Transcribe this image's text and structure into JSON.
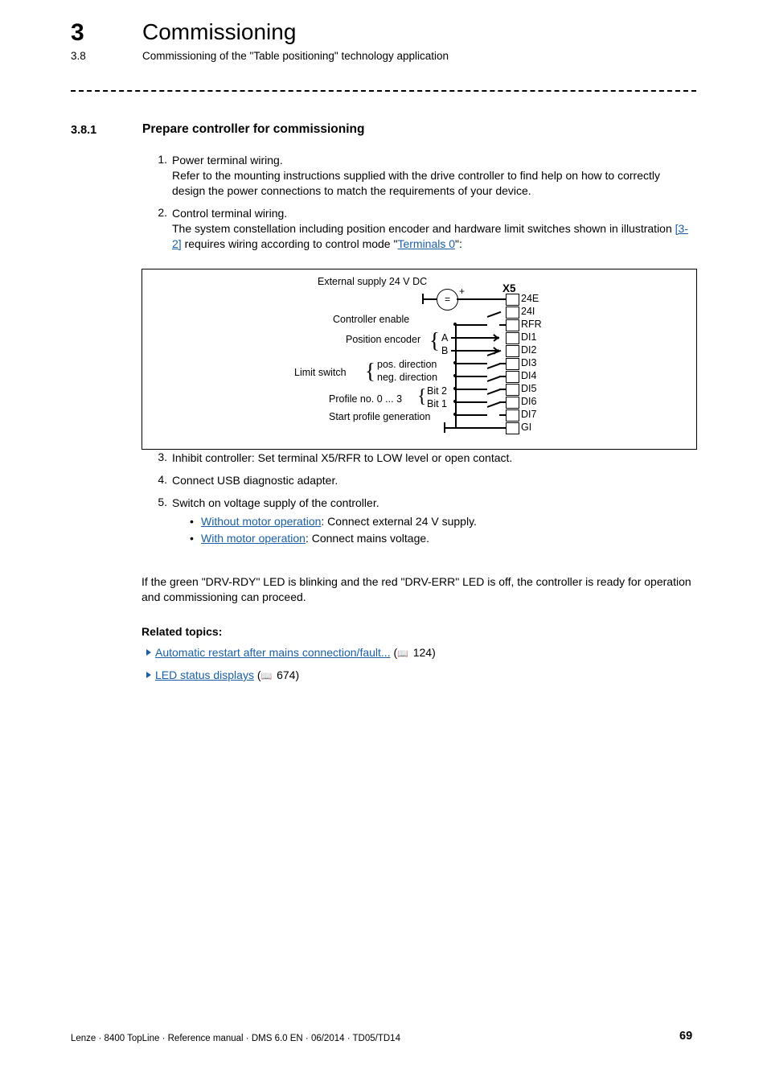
{
  "header": {
    "chapter_number": "3",
    "chapter_title": "Commissioning",
    "section_number": "3.8",
    "section_title": "Commissioning of the \"Table positioning\" technology application"
  },
  "subsection": {
    "number": "3.8.1",
    "title": "Prepare controller for commissioning"
  },
  "steps": [
    {
      "num": "1.",
      "title": "Power terminal wiring.",
      "body": "Refer to the mounting instructions supplied with the drive controller to find help on how to correctly design the power connections to match the requirements of your device."
    },
    {
      "num": "2.",
      "title": "Control terminal wiring.",
      "body_a": "The system constellation including position encoder and hardware limit switches shown in illustration ",
      "link_1": "[3-2]",
      "body_b": " requires wiring according to control mode \"",
      "link_2": "Terminals 0",
      "body_c": "\":"
    },
    {
      "num": "3.",
      "title": "Inhibit controller: Set terminal X5/RFR to LOW level or open contact."
    },
    {
      "num": "4.",
      "title": "Connect USB diagnostic adapter."
    },
    {
      "num": "5.",
      "title": "Switch on voltage supply of the controller."
    }
  ],
  "step5_bullets": [
    {
      "link": "Without motor operation",
      "rest": ": Connect external 24 V supply."
    },
    {
      "link": "With motor operation",
      "rest": ": Connect mains voltage."
    }
  ],
  "closing_paragraph": "If the green \"DRV-RDY\" LED is blinking and the red \"DRV-ERR\" LED is off, the controller is ready for operation and commissioning can proceed.",
  "related": {
    "heading": "Related topics:",
    "items": [
      {
        "label": "Automatic restart after mains connection/fault...",
        "page": "124"
      },
      {
        "label": "LED status displays",
        "page": "674"
      }
    ]
  },
  "figure": {
    "title_supply": "External supply 24 V DC",
    "supply_symbol": "=",
    "supply_plus": "+",
    "connector_name": "X5",
    "labels": [
      "Controller enable",
      "Position encoder",
      "Limit switch",
      "Profile no. 0 ... 3",
      "Start profile generation"
    ],
    "encoder_channels": [
      "A",
      "B"
    ],
    "limit_directions": [
      "pos. direction",
      "neg. direction"
    ],
    "profile_bits": [
      "Bit 2",
      "Bit 1"
    ],
    "terminals": [
      "24E",
      "24I",
      "RFR",
      "DI1",
      "DI2",
      "DI3",
      "DI4",
      "DI5",
      "DI6",
      "DI7",
      "GI"
    ]
  },
  "footer": {
    "left": "Lenze · 8400 TopLine · Reference manual · DMS 6.0 EN · 06/2014 · TD05/TD14",
    "page": "69"
  },
  "colors": {
    "link": "#1a5fa8",
    "text": "#000000",
    "background": "#ffffff"
  }
}
